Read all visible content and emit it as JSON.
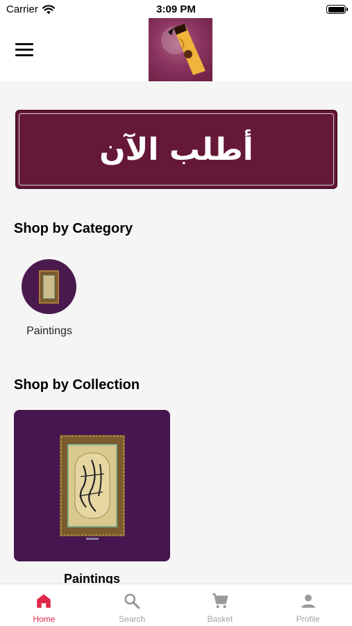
{
  "status_bar": {
    "carrier": "Carrier",
    "time": "3:09 PM"
  },
  "banner": {
    "text": "أطلب الآن"
  },
  "sections": {
    "category_title": "Shop by Category",
    "collection_title": "Shop by Collection"
  },
  "categories": [
    {
      "label": "Paintings"
    }
  ],
  "collections": [
    {
      "label": "Paintings"
    }
  ],
  "tabs": [
    {
      "label": "Home",
      "icon": "home-icon",
      "active": true
    },
    {
      "label": "Search",
      "icon": "search-icon",
      "active": false
    },
    {
      "label": "Basket",
      "icon": "cart-icon",
      "active": false
    },
    {
      "label": "Profile",
      "icon": "person-icon",
      "active": false
    }
  ],
  "colors": {
    "accent": "#e0284a",
    "banner": "#661838",
    "card": "#451650",
    "inactive_tab": "#a0a0a0"
  }
}
